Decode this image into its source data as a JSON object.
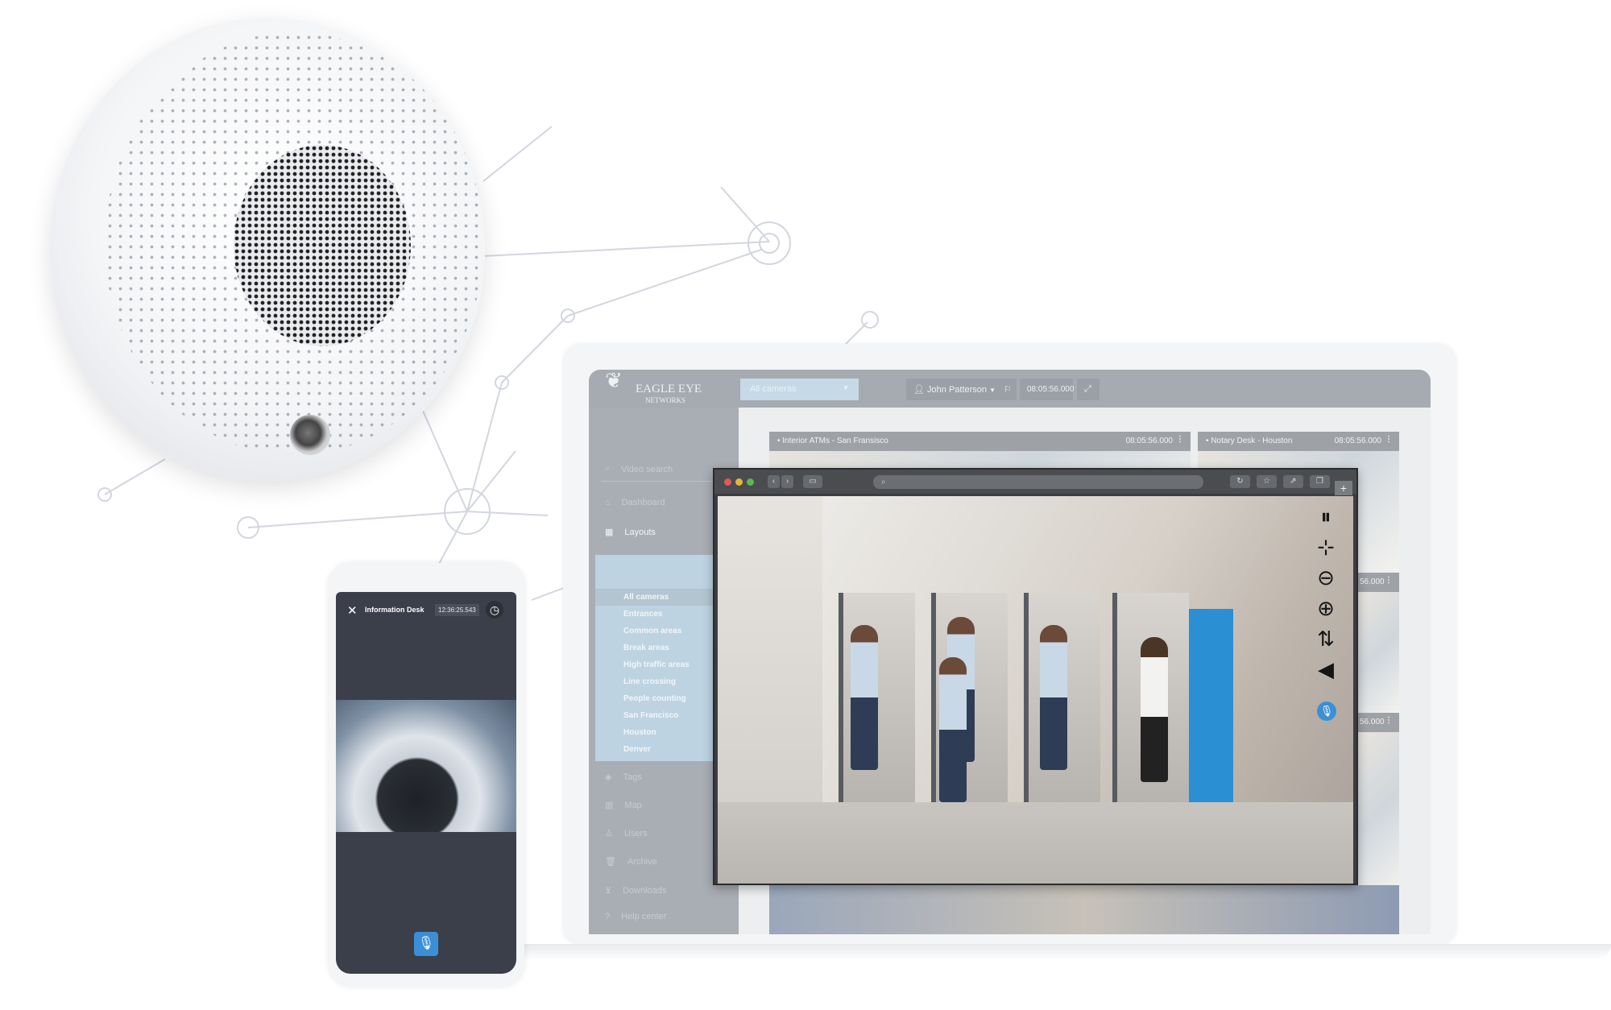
{
  "brand": {
    "name": "EAGLE EYE",
    "sub": "NETWORKS"
  },
  "header": {
    "layout_select": "All cameras",
    "user": "John Patterson",
    "timestamp": "08:05:56.000"
  },
  "sidebar": {
    "search": "Video search",
    "items_top": [
      {
        "label": "Dashboard",
        "icon": "home-icon"
      },
      {
        "label": "Layouts",
        "icon": "grid-icon"
      }
    ],
    "layouts": [
      "All cameras",
      "Entrances",
      "Common areas",
      "Break areas",
      "High traffic areas",
      "Line crossing",
      "People counting",
      "San Francisco",
      "Houston",
      "Denver"
    ],
    "items_bottom": [
      {
        "label": "Tags",
        "icon": "tag-icon"
      },
      {
        "label": "Map",
        "icon": "map-icon"
      },
      {
        "label": "Users",
        "icon": "user-icon"
      },
      {
        "label": "Archive",
        "icon": "trash-icon"
      },
      {
        "label": "Downloads",
        "icon": "download-icon"
      },
      {
        "label": "Help center",
        "icon": "help-icon"
      }
    ]
  },
  "tiles": [
    {
      "title": "Interior ATMs - San Fransisco",
      "time": "08:05:56.000"
    },
    {
      "title": "Notary Desk - Houston",
      "time": "08:05:56.000"
    },
    {
      "title": "",
      "time": "56.000"
    },
    {
      "title": "",
      "time": "56.000"
    }
  ],
  "player_controls": [
    "pause-icon",
    "collapse-icon",
    "zoom-out-icon",
    "zoom-in-icon",
    "swap-icon",
    "speaker-icon",
    "microphone-icon"
  ],
  "phone": {
    "title": "Information Desk",
    "time": "12:36:25.543"
  },
  "colors": {
    "accent": "#3b8fd6",
    "layouts_bg": "#bdd3e2",
    "sidebar": "#a9aeb4"
  }
}
